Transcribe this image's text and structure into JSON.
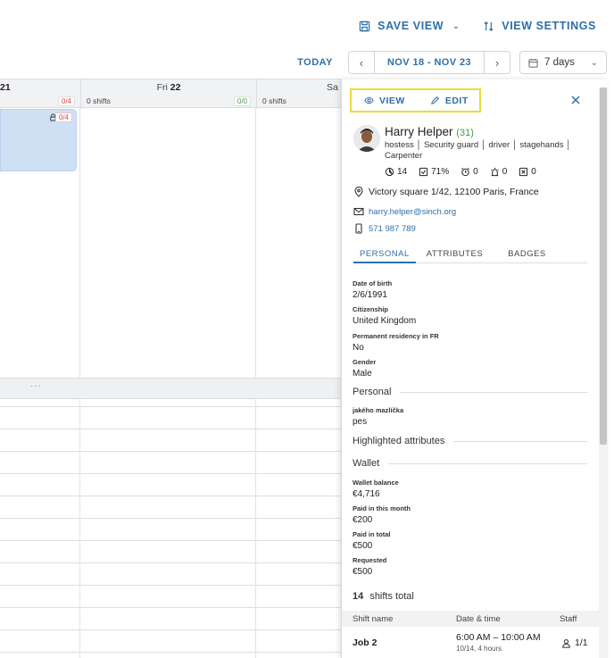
{
  "toolbar": {
    "save_view": "SAVE VIEW",
    "view_settings": "VIEW SETTINGS",
    "today": "TODAY",
    "range": "NOV 18 - NOV 23",
    "days": "7 days"
  },
  "calendar": {
    "columns": [
      {
        "day_name": "",
        "day_num": "21",
        "shifts": "",
        "count": "0/4"
      },
      {
        "day_name": "Fri",
        "day_num": "22",
        "shifts": "0 shifts",
        "count": "0/0"
      },
      {
        "day_name": "Sa",
        "day_num": "",
        "shifts": "0 shifts",
        "count": ""
      }
    ],
    "card_count": "0/4",
    "divider_dots": "···"
  },
  "panel": {
    "view_label": "VIEW",
    "edit_label": "EDIT",
    "name": "Harry Helper",
    "age": "(31)",
    "roles": "hostess │ Security guard │ driver │ stagehands │ Carpenter",
    "stats": [
      "14",
      "71%",
      "0",
      "0",
      "0"
    ],
    "address": "Victory square 1/42, 12100 Paris, France",
    "email": "harry.helper@sinch.org",
    "phone": "571 987 789",
    "tabs": [
      "PERSONAL",
      "ATTRIBUTES",
      "BADGES"
    ],
    "fields": [
      {
        "label": "Date of birth",
        "value": "2/6/1991"
      },
      {
        "label": "Citizenship",
        "value": "United Kingdom"
      },
      {
        "label": "Permanent residency in FR",
        "value": "No"
      },
      {
        "label": "Gender",
        "value": "Male"
      }
    ],
    "section_personal": "Personal",
    "custom_field": {
      "label": "jakého mazlíčka",
      "value": "pes"
    },
    "section_highlighted": "Highlighted attributes",
    "section_wallet": "Wallet",
    "wallet": [
      {
        "label": "Wallet balance",
        "value": "€4,716"
      },
      {
        "label": "Paid in this month",
        "value": "€200"
      },
      {
        "label": "Paid in total",
        "value": "€500"
      },
      {
        "label": "Requested",
        "value": "€500"
      }
    ],
    "shifts_total_num": "14",
    "shifts_total_text": "shifts total",
    "table_headers": [
      "Shift name",
      "Date & time",
      "Staff"
    ],
    "table_row": {
      "name": "Job 2",
      "time": "6:00 AM – 10:00 AM",
      "duration": "10/14, 4 hours",
      "staff": "1/1"
    }
  },
  "colors": {
    "accent": "#2f6fa7",
    "highlight": "#e8dc3c",
    "card": "#cfe0f4",
    "warn": "#d84a4a",
    "ok": "#4a9a4a"
  }
}
